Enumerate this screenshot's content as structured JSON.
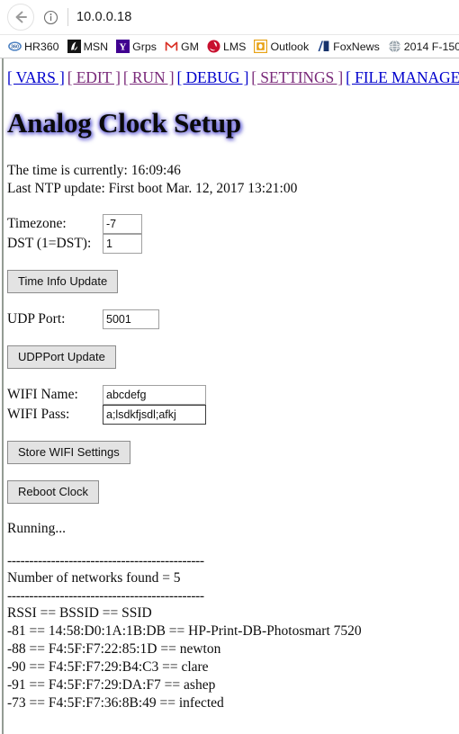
{
  "browser": {
    "back_icon": "back-arrow-icon",
    "info_icon": "info-circle-icon",
    "url": "10.0.0.18",
    "bookmarks": [
      {
        "label": "HR360",
        "icon": "hr360-icon"
      },
      {
        "label": "MSN",
        "icon": "msn-icon"
      },
      {
        "label": "Grps",
        "icon": "yahoo-groups-icon"
      },
      {
        "label": "GM",
        "icon": "gmail-icon"
      },
      {
        "label": "LMS",
        "icon": "lms-icon"
      },
      {
        "label": "Outlook",
        "icon": "outlook-icon"
      },
      {
        "label": "FoxNews",
        "icon": "foxnews-icon"
      },
      {
        "label": "2014 F-150",
        "icon": "globe-icon"
      }
    ]
  },
  "nav": {
    "links": [
      {
        "label": "[ VARS ]",
        "state": "unvisited"
      },
      {
        "label": "[ EDIT ]",
        "state": "visited"
      },
      {
        "label": "[ RUN ]",
        "state": "visited"
      },
      {
        "label": "[ DEBUG ]",
        "state": "unvisited"
      },
      {
        "label": "[ SETTINGS ]",
        "state": "visited"
      },
      {
        "label": "[ FILE MANAGER ]",
        "state": "unvisited"
      }
    ]
  },
  "page": {
    "title": "Analog Clock Setup",
    "current_time_line": "The time is currently: 16:09:46",
    "ntp_update_line": "Last NTP update: First boot Mar. 12, 2017 13:21:00",
    "status_text": "Running..."
  },
  "time_form": {
    "timezone_label": "Timezone:",
    "timezone_value": "-7",
    "dst_label": "DST (1=DST):",
    "dst_value": "1",
    "submit_label": "Time Info Update"
  },
  "udp_form": {
    "port_label": "UDP Port:",
    "port_value": "5001",
    "submit_label": "UDPPort Update"
  },
  "wifi_form": {
    "name_label": "WIFI Name:",
    "name_value": "abcdefg",
    "pass_label": "WIFI Pass:",
    "pass_value": "a;lsdkfjsdl;afkj",
    "submit_label": "Store WIFI Settings"
  },
  "reboot": {
    "button_label": "Reboot Clock"
  },
  "scan": {
    "divider": "---------------------------------------------",
    "count_line": "Number of networks found = 5",
    "header_line": "RSSI == BSSID == SSID",
    "networks": [
      {
        "line": "-81 == 14:58:D0:1A:1B:DB == HP-Print-DB-Photosmart 7520"
      },
      {
        "line": "-88 == F4:5F:F7:22:85:1D == newton"
      },
      {
        "line": "-90 == F4:5F:F7:29:B4:C3 == clare"
      },
      {
        "line": "-91 == F4:5F:F7:29:DA:F7 == ashep"
      },
      {
        "line": "-73 == F4:5F:F7:36:8B:49 == infected"
      }
    ]
  },
  "colors": {
    "link_unvisited": "#0000cc",
    "link_visited": "#7a2a7a",
    "title_glow": "#5a5adc"
  }
}
